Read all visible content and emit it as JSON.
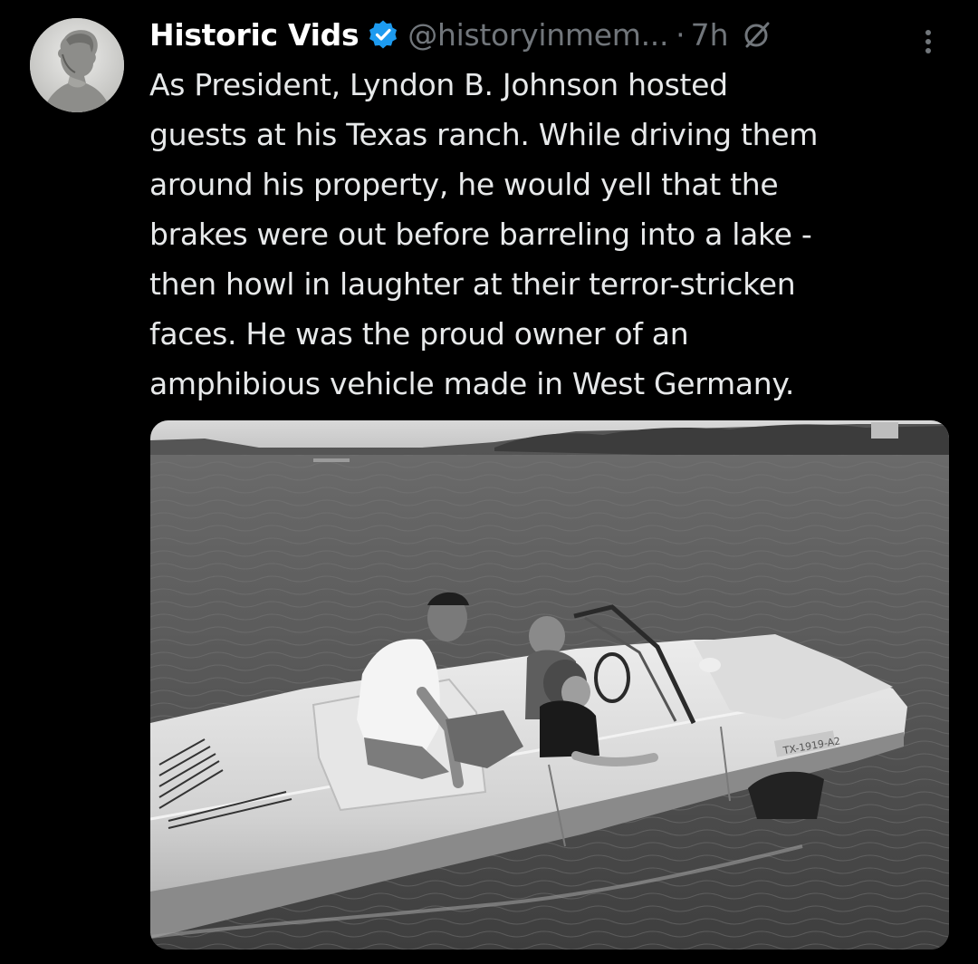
{
  "tweet": {
    "author": {
      "display_name": "Historic Vids",
      "handle": "@historyinmem...",
      "separator": "·",
      "time": "7h"
    },
    "text_lines": [
      "As President, Lyndon B. Johnson hosted",
      "guests at his Texas ranch. While driving them",
      "around his property, he would yell that the",
      "brakes were out before barreling into a lake -",
      "then howl in laughter at their terror-stricken",
      "faces. He was the proud owner of an",
      "amphibious vehicle made in West Germany."
    ],
    "media": {
      "license_plate_text": "TX-1919-A2"
    },
    "icons": {
      "avatar": "bust-portrait-avatar",
      "verified": "verified-badge-icon",
      "grok": "circle-slash-icon",
      "more": "more-vertical-icon"
    },
    "colors": {
      "background": "#000000",
      "text": "#e7e9ea",
      "secondary": "#71767b",
      "verified": "#1d9bf0"
    }
  }
}
